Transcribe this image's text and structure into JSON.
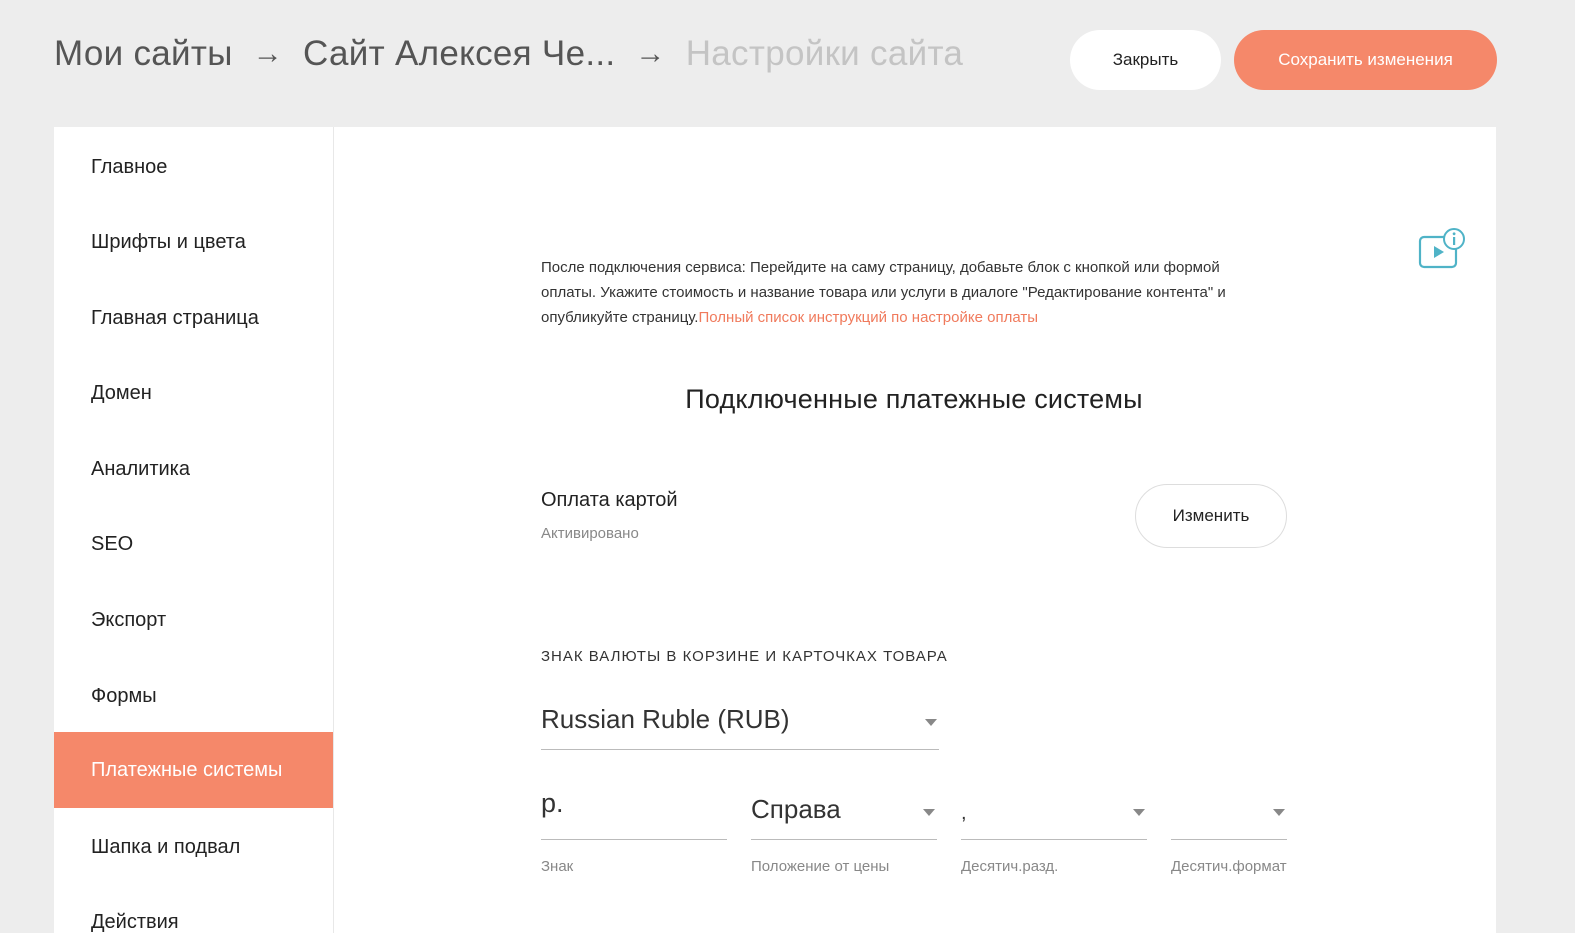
{
  "breadcrumb": {
    "items": [
      "Мои сайты",
      "Сайт Алексея Че...",
      "Настройки сайта"
    ],
    "separator": "→"
  },
  "header": {
    "close_label": "Закрыть",
    "save_label": "Сохранить изменения"
  },
  "sidebar": {
    "active_index": 8,
    "items": [
      {
        "label": "Главное"
      },
      {
        "label": "Шрифты и цвета"
      },
      {
        "label": "Главная страница"
      },
      {
        "label": "Домен"
      },
      {
        "label": "Аналитика"
      },
      {
        "label": "SEO"
      },
      {
        "label": "Экспорт"
      },
      {
        "label": "Формы"
      },
      {
        "label": "Платежные системы"
      },
      {
        "label": "Шапка и подвал"
      },
      {
        "label": "Действия"
      }
    ]
  },
  "content": {
    "intro_text": "После подключения сервиса: Перейдите на саму страницу, добавьте блок с кнопкой или формой оплаты. Укажите стоимость и название товара или услуги в диалоге \"Редактирование контента\" и опубликуйте страницу.",
    "intro_link": "Полный список инструкций по настройке оплаты",
    "section_title": "Подключенные платежные системы",
    "payment": {
      "name": "Оплата картой",
      "status": "Активировано",
      "edit_label": "Изменить"
    },
    "currency": {
      "label": "ЗНАК ВАЛЮТЫ В КОРЗИНЕ И КАРТОЧКАХ ТОВАРА",
      "selected": "Russian Ruble (RUB)",
      "sign_value": "р.",
      "sign_caption": "Знак",
      "position_value": "Справа",
      "position_caption": "Положение от цены",
      "decimal_sep_value": ",",
      "decimal_sep_caption": "Десятич.разд.",
      "decimal_format_value": "",
      "decimal_format_caption": "Десятич.формат"
    }
  },
  "colors": {
    "accent": "#f5886a",
    "link": "#f07a5c",
    "icon": "#4fb3c7",
    "background": "#ededed"
  },
  "icons": {
    "info": "video-info-icon",
    "dropdown": "chevron-down-icon"
  }
}
